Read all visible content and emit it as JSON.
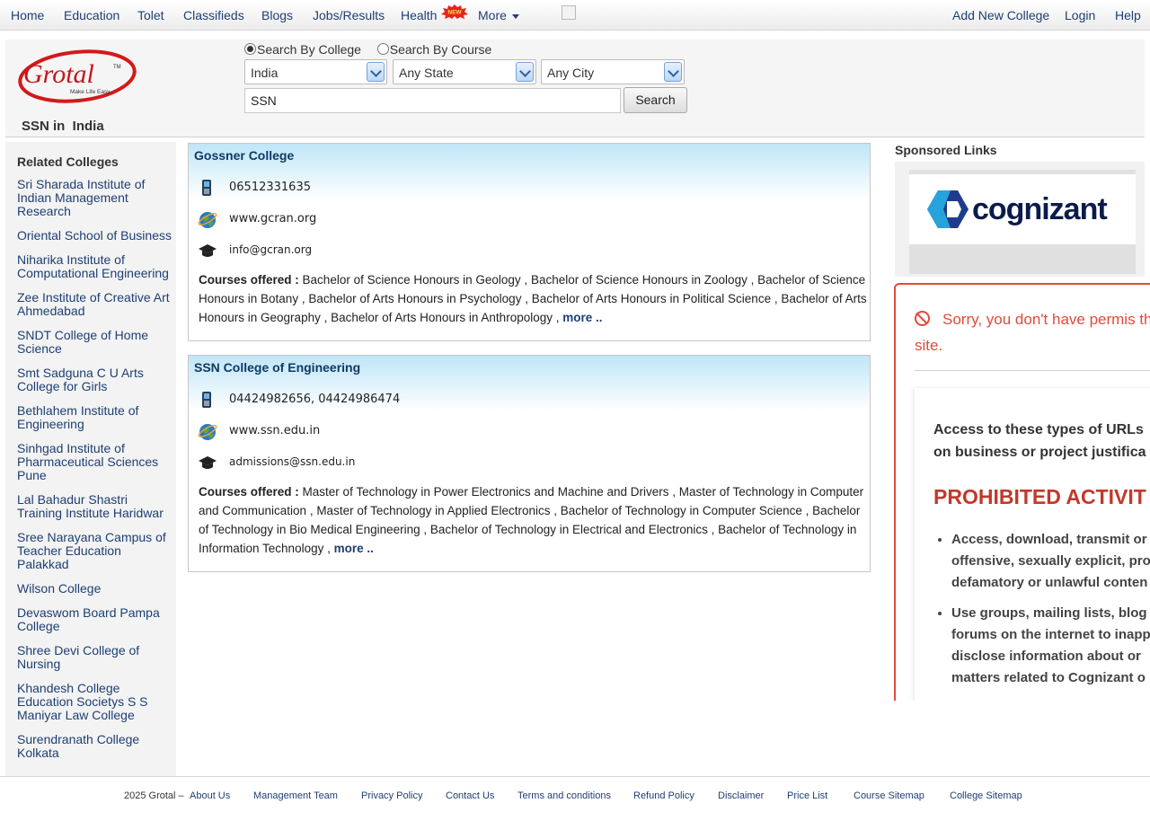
{
  "topnav": {
    "home": "Home",
    "education": "Education",
    "tolet": "Tolet",
    "classifieds": "Classifieds",
    "blogs": "Blogs",
    "jobs": "Jobs/Results",
    "health": "Health",
    "new_badge": "NEW",
    "more": "More",
    "add_college": "Add New College",
    "login": "Login",
    "help": "Help"
  },
  "search": {
    "radio_college": "Search By College",
    "radio_course": "Search By Course",
    "country": "India",
    "state": "Any State",
    "city": "Any City",
    "query": "SSN",
    "button": "Search"
  },
  "logo": {
    "text": "Grotal",
    "tagline": "Make Life Easy",
    "tm": "TM"
  },
  "page_heading": "SSN in  India",
  "sidebar": {
    "title": "Related Colleges",
    "items": [
      "Sri Sharada Institute of Indian Management Research",
      "Oriental School of Business",
      "Niharika Institute of Computational Engineering",
      "Zee Institute of Creative Art Ahmedabad",
      "SNDT College of Home Science",
      "Smt Sadguna C U Arts College for Girls",
      "Bethlahem Institute of Engineering",
      "Sinhgad Institute of Pharmaceutical Sciences Pune",
      "Lal Bahadur Shastri Training Institute Haridwar",
      "Sree Narayana Campus of Teacher Education Palakkad",
      "Wilson College",
      "Devaswom Board Pampa College",
      "Shree Devi College of Nursing",
      "Khandesh College Education Societys S S Maniyar Law College",
      "Surendranath College Kolkata"
    ]
  },
  "results": [
    {
      "name": "Gossner College",
      "phone": "06512331635",
      "website": "www.gcran.org",
      "email": "info@gcran.org",
      "courses_label": "Courses offered :",
      "courses": "Bachelor of Science Honours in Geology , Bachelor of Science Honours in Zoology , Bachelor of Science Honours in Botany , Bachelor of Arts Honours in Psychology , Bachelor of Arts Honours in Political Science , Bachelor of Arts Honours in Geography , Bachelor of Arts Honours in Anthropology ,",
      "more": "more .."
    },
    {
      "name": "SSN College of Engineering",
      "phone": "04424982656, 04424986474",
      "website": "www.ssn.edu.in",
      "email": "admissions@ssn.edu.in",
      "courses_label": "Courses offered :",
      "courses": "Master of Technology in Power Electronics and Machine and Drivers , Master of Technology in Computer and Communication , Master of Technology in Applied Electronics , Bachelor of Technology in Computer Science , Bachelor of Technology in Bio Medical Engineering , Bachelor of Technology in Electrical and Electronics , Bachelor of Technology in Information Technology ,",
      "more": "more .."
    }
  ],
  "right": {
    "sponsored": "Sponsored Links",
    "ad_brand": "cognizant",
    "blocked_msg": "Sorry, you don't have permis this site.",
    "access_text_1": "Access to these types of URLs",
    "access_text_2": "on business or project justifica",
    "prohibited": "PROHIBITED ACTIVIT",
    "bullets": [
      [
        "Access, download, transmit or",
        "offensive, sexually explicit, pro",
        "defamatory or unlawful conten"
      ],
      [
        "Use groups, mailing lists, blog",
        "forums on the internet to inapp",
        "disclose information about or",
        "matters related to Cognizant o"
      ]
    ]
  },
  "footer": {
    "copyright": "2025 Grotal –",
    "links": [
      "About Us",
      "Management Team",
      "Privacy Policy",
      "Contact Us",
      "Terms and conditions",
      "Refund Policy",
      "Disclaimer",
      "Price List",
      "Course Sitemap",
      "College Sitemap"
    ]
  },
  "colors": {
    "nav_link": "#1d3f73",
    "card_header": "#bfe6f7",
    "blocked_red": "#e34a3a"
  }
}
